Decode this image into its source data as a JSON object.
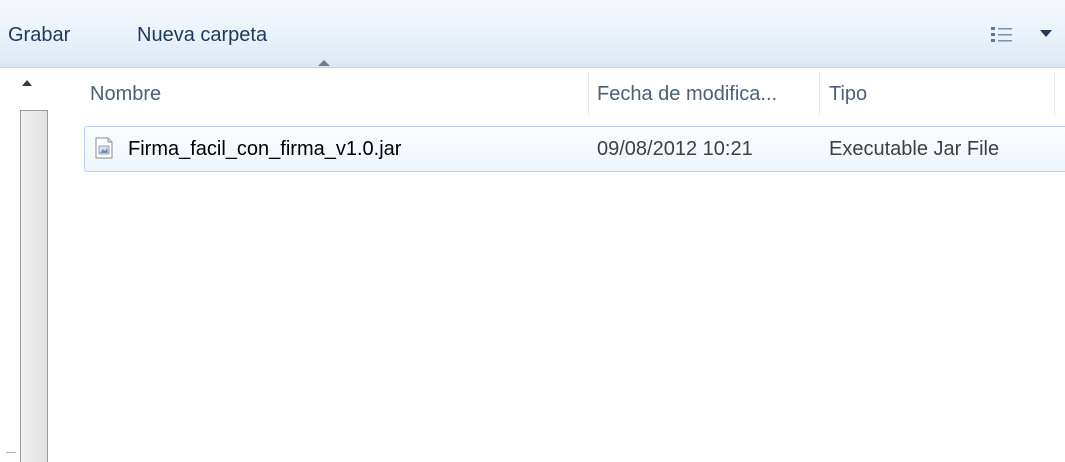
{
  "toolbar": {
    "grabar_label": "Grabar",
    "new_folder_label": "Nueva carpeta",
    "view_icon": "details-view-icon",
    "view_dropdown_icon": "chevron-down-icon"
  },
  "columns": {
    "name": "Nombre",
    "date": "Fecha de modifica...",
    "type": "Tipo",
    "sorted_by": "Nombre"
  },
  "files": [
    {
      "name": "Firma_facil_con_firma_v1.0.jar",
      "date": "09/08/2012 10:21",
      "type": "Executable Jar File",
      "icon": "jar-file-icon"
    }
  ],
  "colors": {
    "toolbar_top": "#f5f9fd",
    "toolbar_bottom": "#dde8f5",
    "text": "#1e395b",
    "header_text": "#4c607a",
    "row_selected_border": "#b9d1ee"
  }
}
